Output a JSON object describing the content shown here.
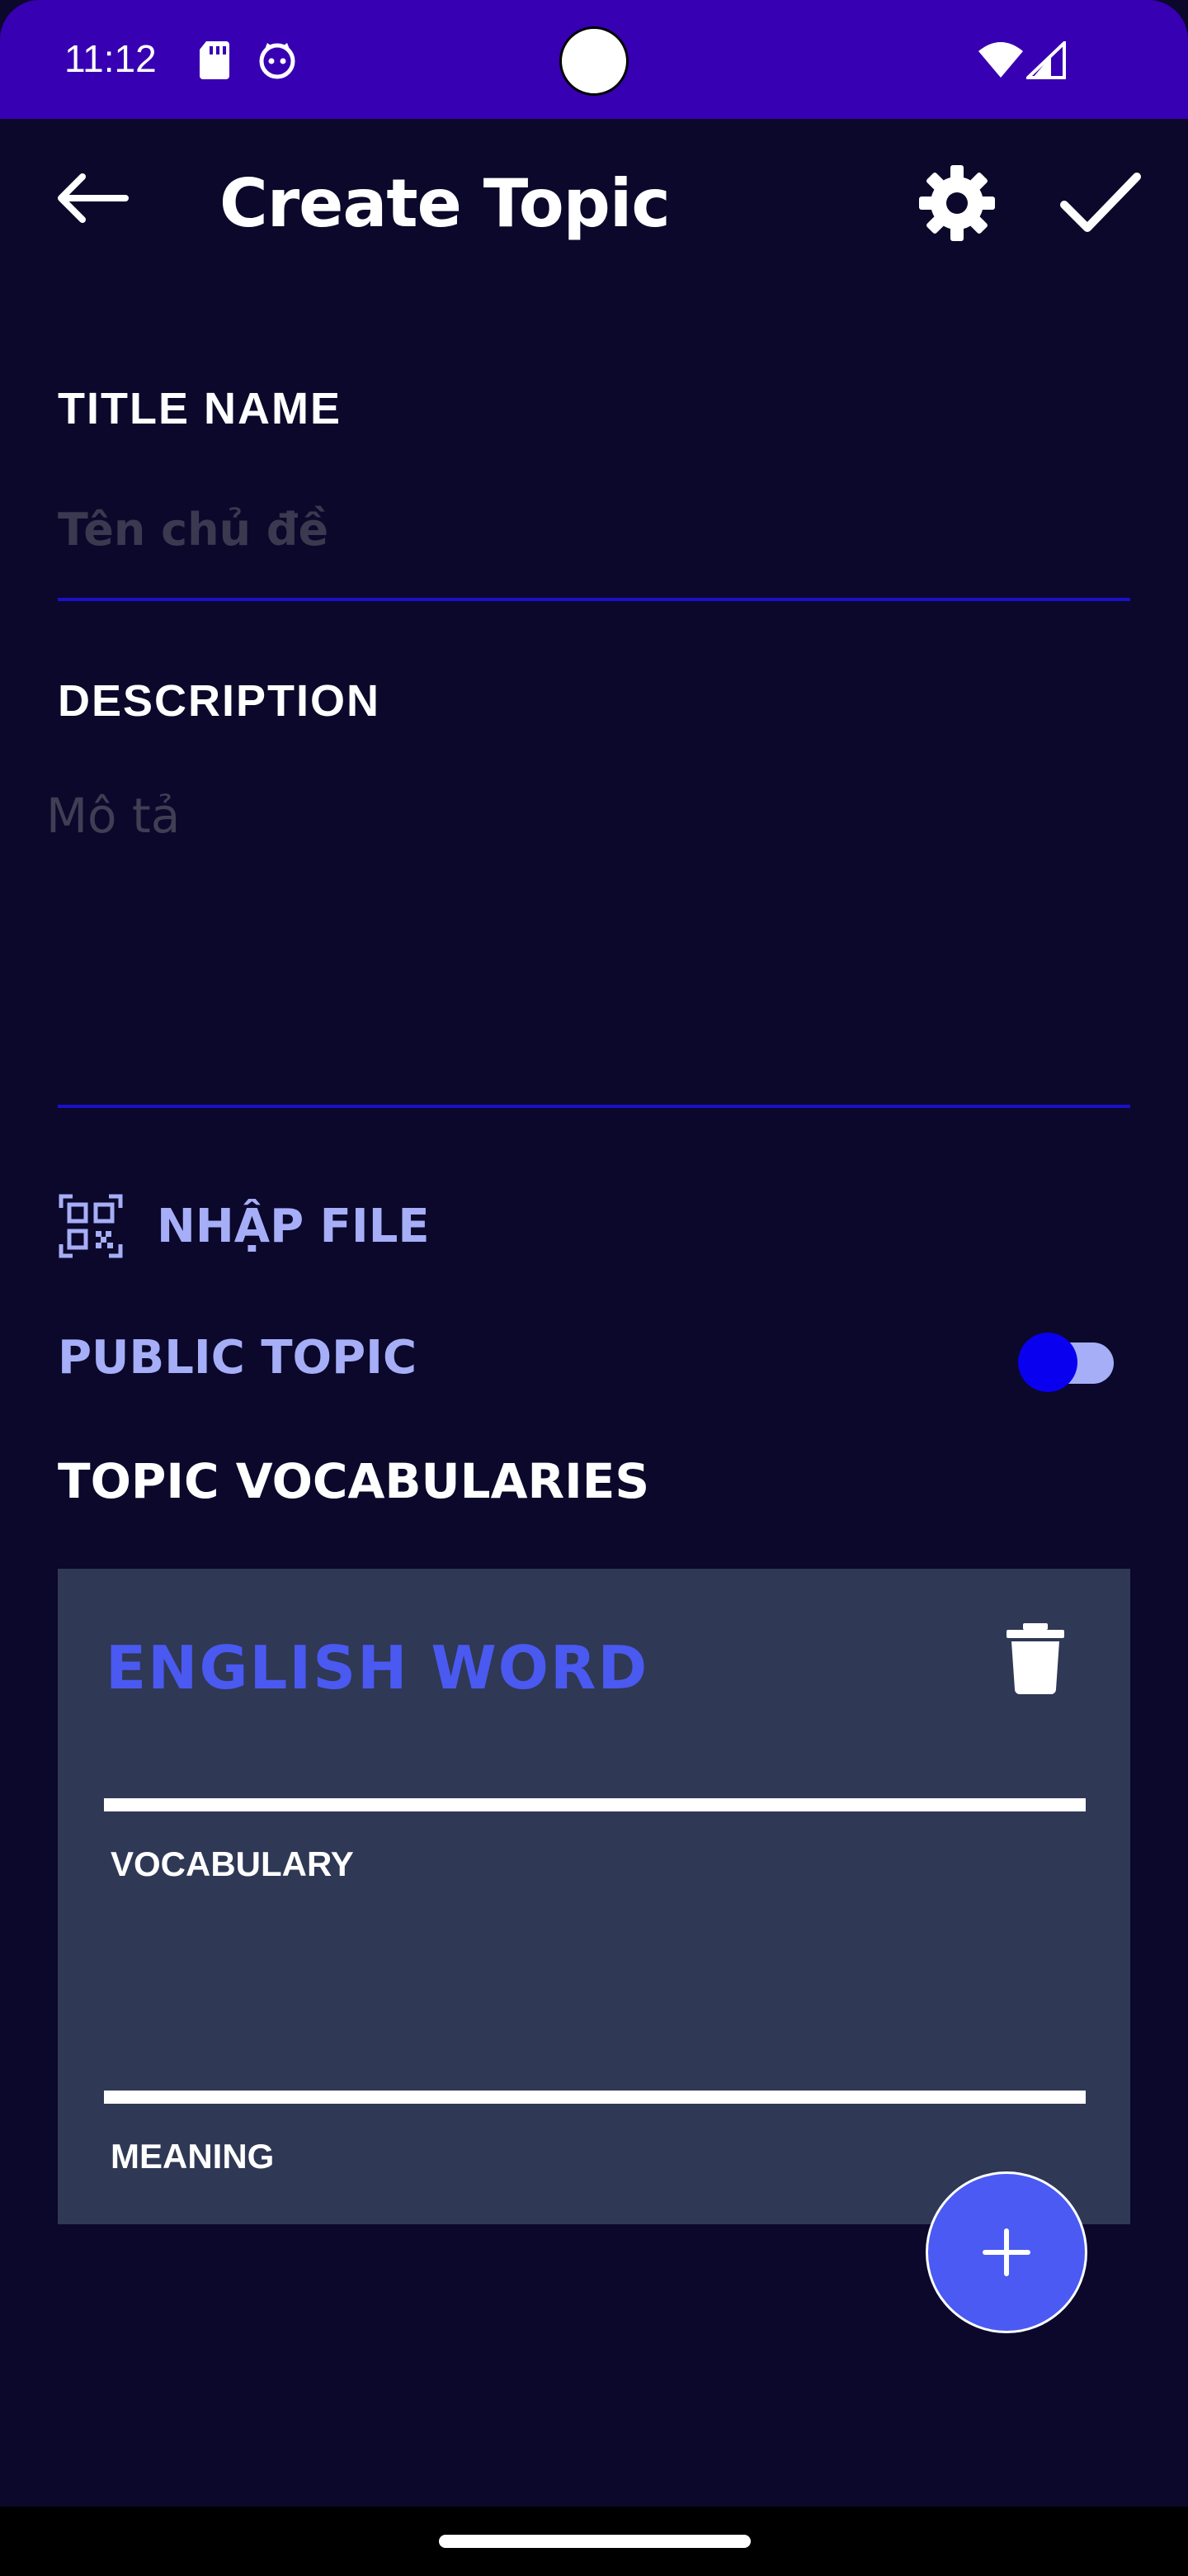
{
  "status_bar": {
    "time": "11:12",
    "icons": [
      "sd-card-icon",
      "face-icon",
      "wifi-icon",
      "signal-icon"
    ]
  },
  "toolbar": {
    "title": "Create Topic",
    "back_icon": "arrow-left-icon",
    "settings_icon": "gear-icon",
    "confirm_icon": "check-icon"
  },
  "form": {
    "title_label": "TITLE NAME",
    "title_placeholder": "Tên chủ đề",
    "title_value": "",
    "description_label": "DESCRIPTION",
    "description_placeholder": "Mô tả",
    "description_value": "",
    "import_label": "NHẬP FILE",
    "public_label": "PUBLIC TOPIC",
    "public_enabled": true,
    "vocab_heading": "TOPIC VOCABULARIES"
  },
  "vocab_card": {
    "title": "ENGLISH WORD",
    "vocabulary_label": "VOCABULARY",
    "meaning_label": "MEANING"
  },
  "colors": {
    "status_bar": "#3700b3",
    "background": "#0b082b",
    "accent": "#4a5af2",
    "underline": "#1a10c8",
    "card": "#2f3855",
    "light_accent": "#a6aef7"
  },
  "fab": {
    "icon": "plus-icon"
  }
}
